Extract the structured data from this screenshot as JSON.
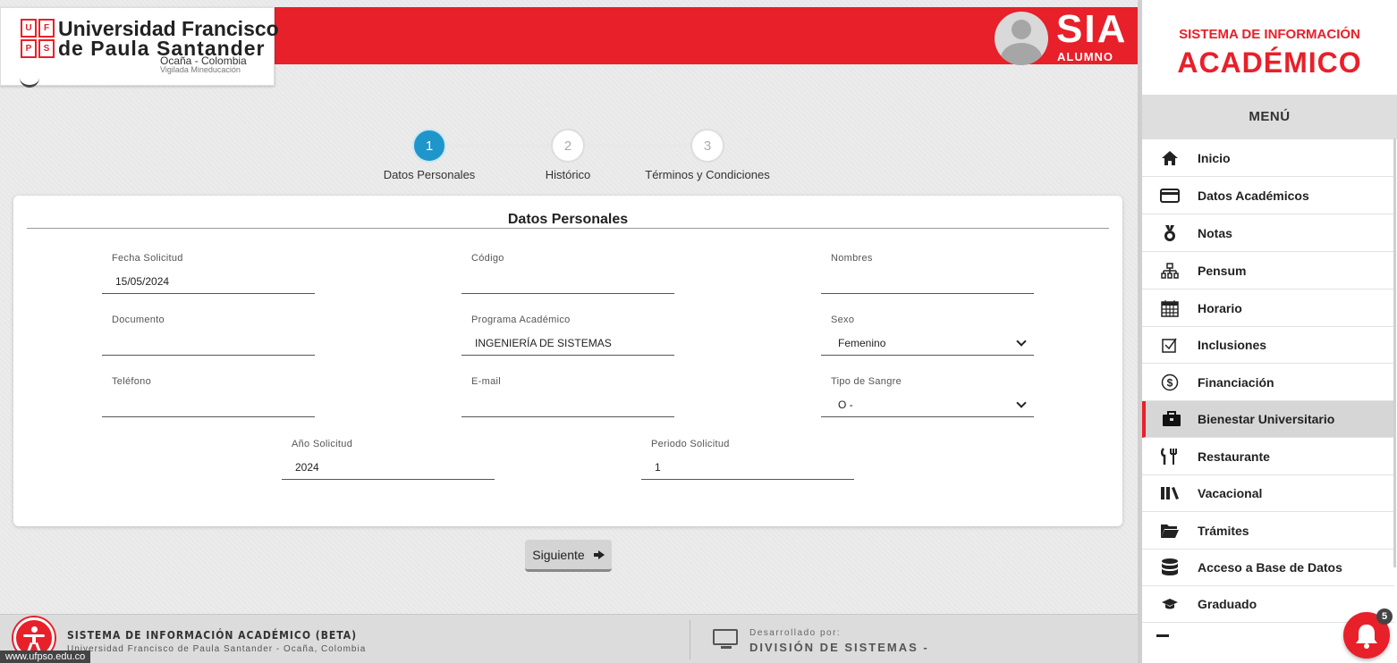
{
  "header": {
    "university_line1": "Universidad Francisco",
    "university_line2": "de Paula Santander",
    "university_line3": "Ocaña - Colombia",
    "university_line4": "Vigilada Mineducación",
    "logo_letters": [
      "U",
      "F",
      "P",
      "S"
    ],
    "app_name": "SIA",
    "app_role": "ALUMNO",
    "brand_color": "#e8202a"
  },
  "stepper": {
    "steps": [
      {
        "number": "1",
        "label": "Datos Personales"
      },
      {
        "number": "2",
        "label": "Histórico"
      },
      {
        "number": "3",
        "label": "Términos y Condiciones"
      }
    ],
    "active_step": 1
  },
  "form": {
    "title": "Datos Personales",
    "fields": {
      "fecha_solicitud": {
        "label": "Fecha Solicitud",
        "value": "15/05/2024"
      },
      "codigo": {
        "label": "Código",
        "value": ""
      },
      "nombres": {
        "label": "Nombres",
        "value": ""
      },
      "documento": {
        "label": "Documento",
        "value": ""
      },
      "programa": {
        "label": "Programa Académico",
        "value": "INGENIERÍA DE SISTEMAS"
      },
      "sexo": {
        "label": "Sexo",
        "value": "Femenino"
      },
      "telefono": {
        "label": "Teléfono",
        "value": ""
      },
      "email": {
        "label": "E-mail",
        "value": ""
      },
      "tipo_sangre": {
        "label": "Tipo de Sangre",
        "value": "O -"
      },
      "anio_solicitud": {
        "label": "Año Solicitud",
        "value": "2024"
      },
      "periodo_solicitud": {
        "label": "Periodo Solicitud",
        "value": "1"
      }
    },
    "next_label": "Siguiente"
  },
  "footer": {
    "system_name": "SISTEMA DE INFORMACIÓN ACADÉMICO (BETA)",
    "institution": "Universidad Francisco de Paula Santander - Ocaña, Colombia",
    "developed_by_label": "Desarrollado por:",
    "developer": "DIVISIÓN DE SISTEMAS -",
    "url": "www.ufpso.edu.co"
  },
  "sidebar": {
    "title_line1": "SISTEMA DE INFORMACIÓN",
    "title_line2": "ACADÉMICO",
    "menu_label": "MENÚ",
    "items": [
      {
        "label": "Inicio",
        "icon": "home-icon"
      },
      {
        "label": "Datos Académicos",
        "icon": "card-icon"
      },
      {
        "label": "Notas",
        "icon": "medal-icon"
      },
      {
        "label": "Pensum",
        "icon": "sitemap-icon"
      },
      {
        "label": "Horario",
        "icon": "calendar-icon"
      },
      {
        "label": "Inclusiones",
        "icon": "checkbox-icon"
      },
      {
        "label": "Financiación",
        "icon": "dollar-icon"
      },
      {
        "label": "Bienestar Universitario",
        "icon": "briefcase-icon"
      },
      {
        "label": "Restaurante",
        "icon": "utensils-icon"
      },
      {
        "label": "Vacacional",
        "icon": "books-icon"
      },
      {
        "label": "Trámites",
        "icon": "folder-icon"
      },
      {
        "label": "Acceso a Base de Datos",
        "icon": "database-icon"
      },
      {
        "label": "Graduado",
        "icon": "graduation-cap-icon"
      }
    ],
    "active_item": "Bienestar Universitario"
  },
  "notifications": {
    "count": "5"
  }
}
